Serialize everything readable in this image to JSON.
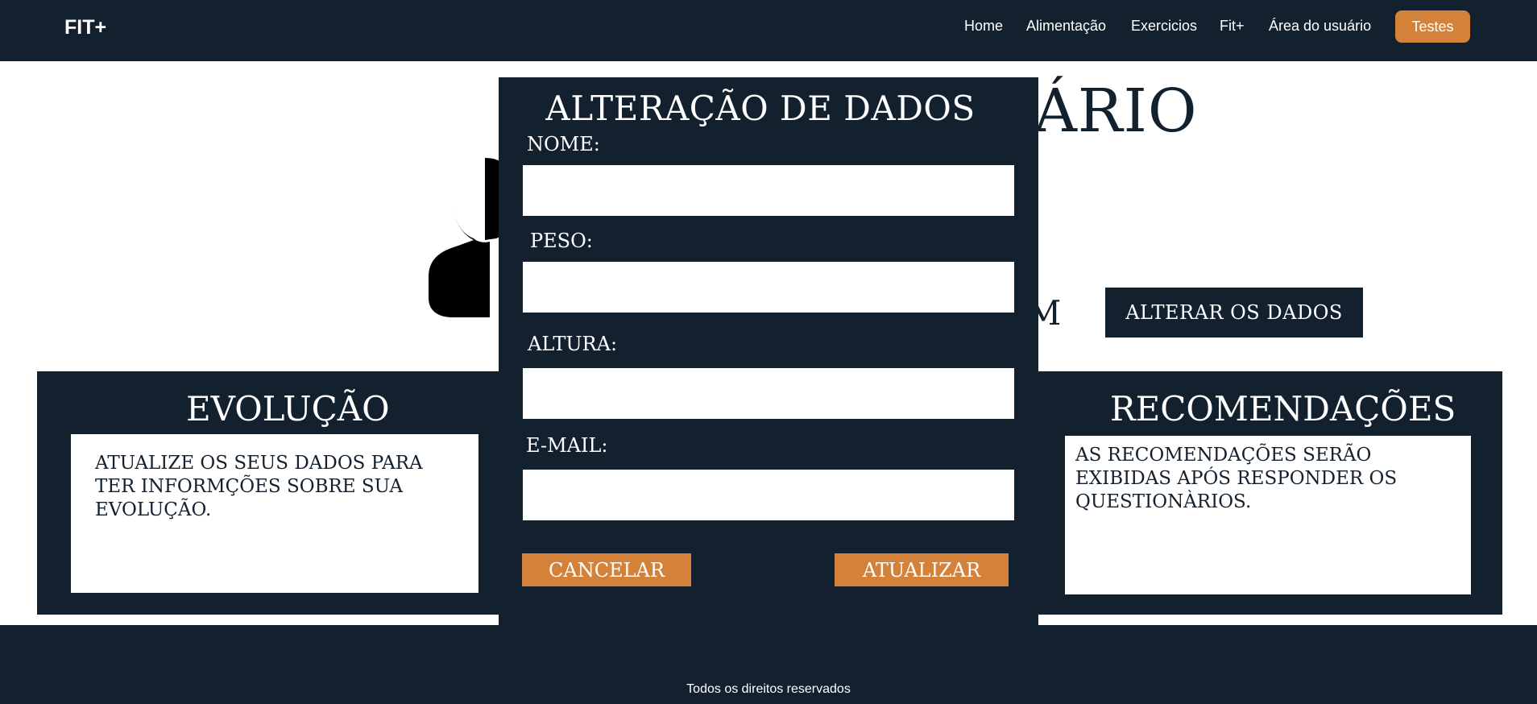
{
  "navbar": {
    "brand": "FIT+",
    "links": [
      "Home",
      "Alimentação",
      "Exercicios",
      "Fit+",
      "Área do usuário"
    ],
    "cta": "Testes"
  },
  "page": {
    "title_visible": "ÁRIO",
    "welcome_visible": "OM",
    "alter_button": "ALTERAR OS DADOS",
    "avatar_icon": "user-silhouette-icon"
  },
  "evolution": {
    "title": "EVOLUÇÃO",
    "message": "ATUALIZE OS SEUS DADOS PARA TER INFORMÇÕES SOBRE SUA EVOLUÇÃO."
  },
  "recommendations": {
    "title": "RECOMENDAÇÕES",
    "message": "AS RECOMENDAÇÕES SERÃO EXIBIDAS APÓS RESPONDER OS QUESTIONÀRIOS."
  },
  "modal": {
    "title": "ALTERAÇÃO DE DADOS",
    "fields": {
      "name": {
        "label": "NOME:",
        "value": ""
      },
      "weight": {
        "label": "PESO:",
        "value": ""
      },
      "height": {
        "label": "ALTURA:",
        "value": ""
      },
      "email": {
        "label": "E-MAIL:",
        "value": ""
      }
    },
    "cancel": "CANCELAR",
    "update": "ATUALIZAR"
  },
  "footer": {
    "text": "Todos os direitos reservados"
  },
  "colors": {
    "navy": "#13212f",
    "accent": "#d4823a",
    "white": "#ffffff"
  }
}
